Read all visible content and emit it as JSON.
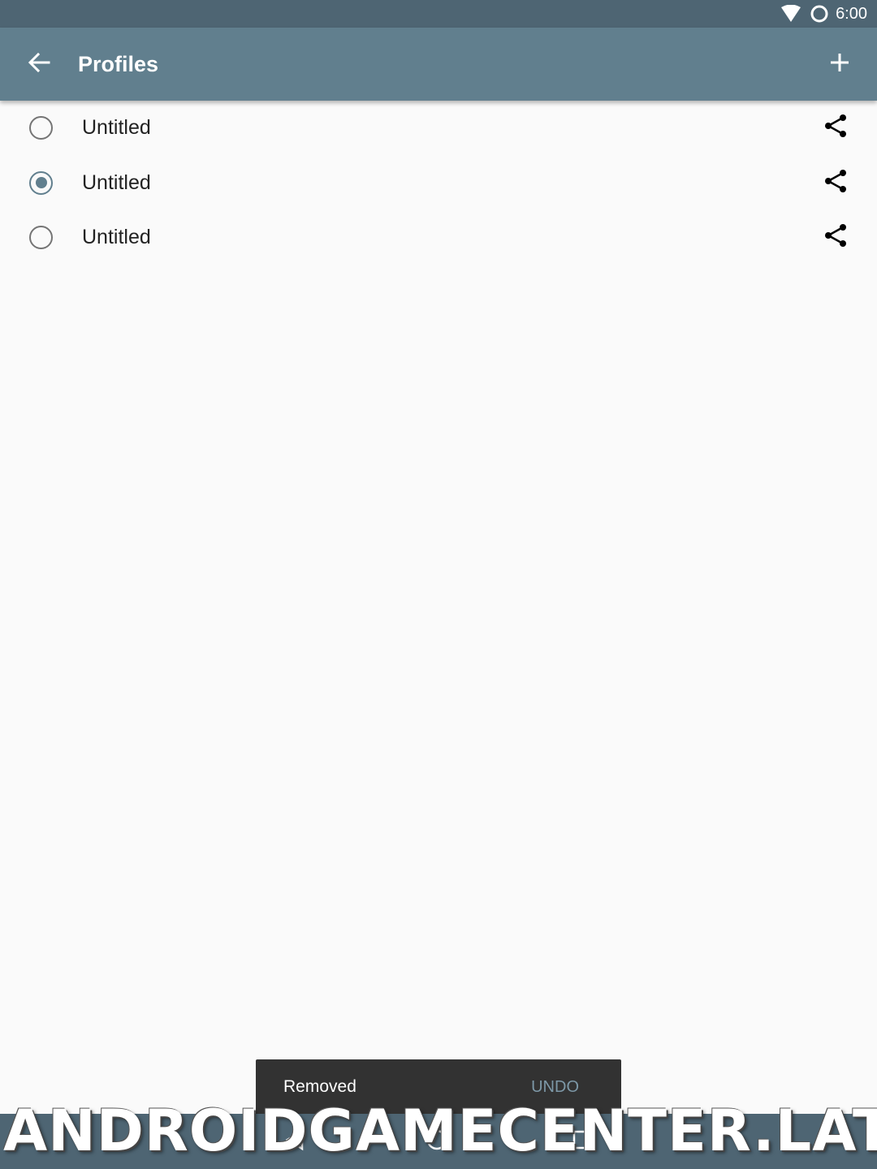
{
  "status_bar": {
    "time": "6:00",
    "icons": [
      "wifi-icon",
      "sync-circle-icon"
    ]
  },
  "app_bar": {
    "title": "Profiles",
    "back_icon": "arrow-back-icon",
    "add_icon": "plus-icon"
  },
  "profiles": [
    {
      "name": "Untitled",
      "selected": false
    },
    {
      "name": "Untitled",
      "selected": true
    },
    {
      "name": "Untitled",
      "selected": false
    }
  ],
  "snackbar": {
    "message": "Removed",
    "action": "UNDO"
  },
  "nav_bar": {
    "icons": [
      "nav-back-icon",
      "nav-home-icon",
      "nav-recents-icon"
    ]
  },
  "watermark": "ANDROIDGAMECENTER.LAT",
  "colors": {
    "status_bar": "#4e6573",
    "app_bar": "#617f8e",
    "accent": "#617f8e",
    "background": "#fafafa",
    "snackbar": "#323232",
    "snackbar_action": "#7d98a7"
  }
}
